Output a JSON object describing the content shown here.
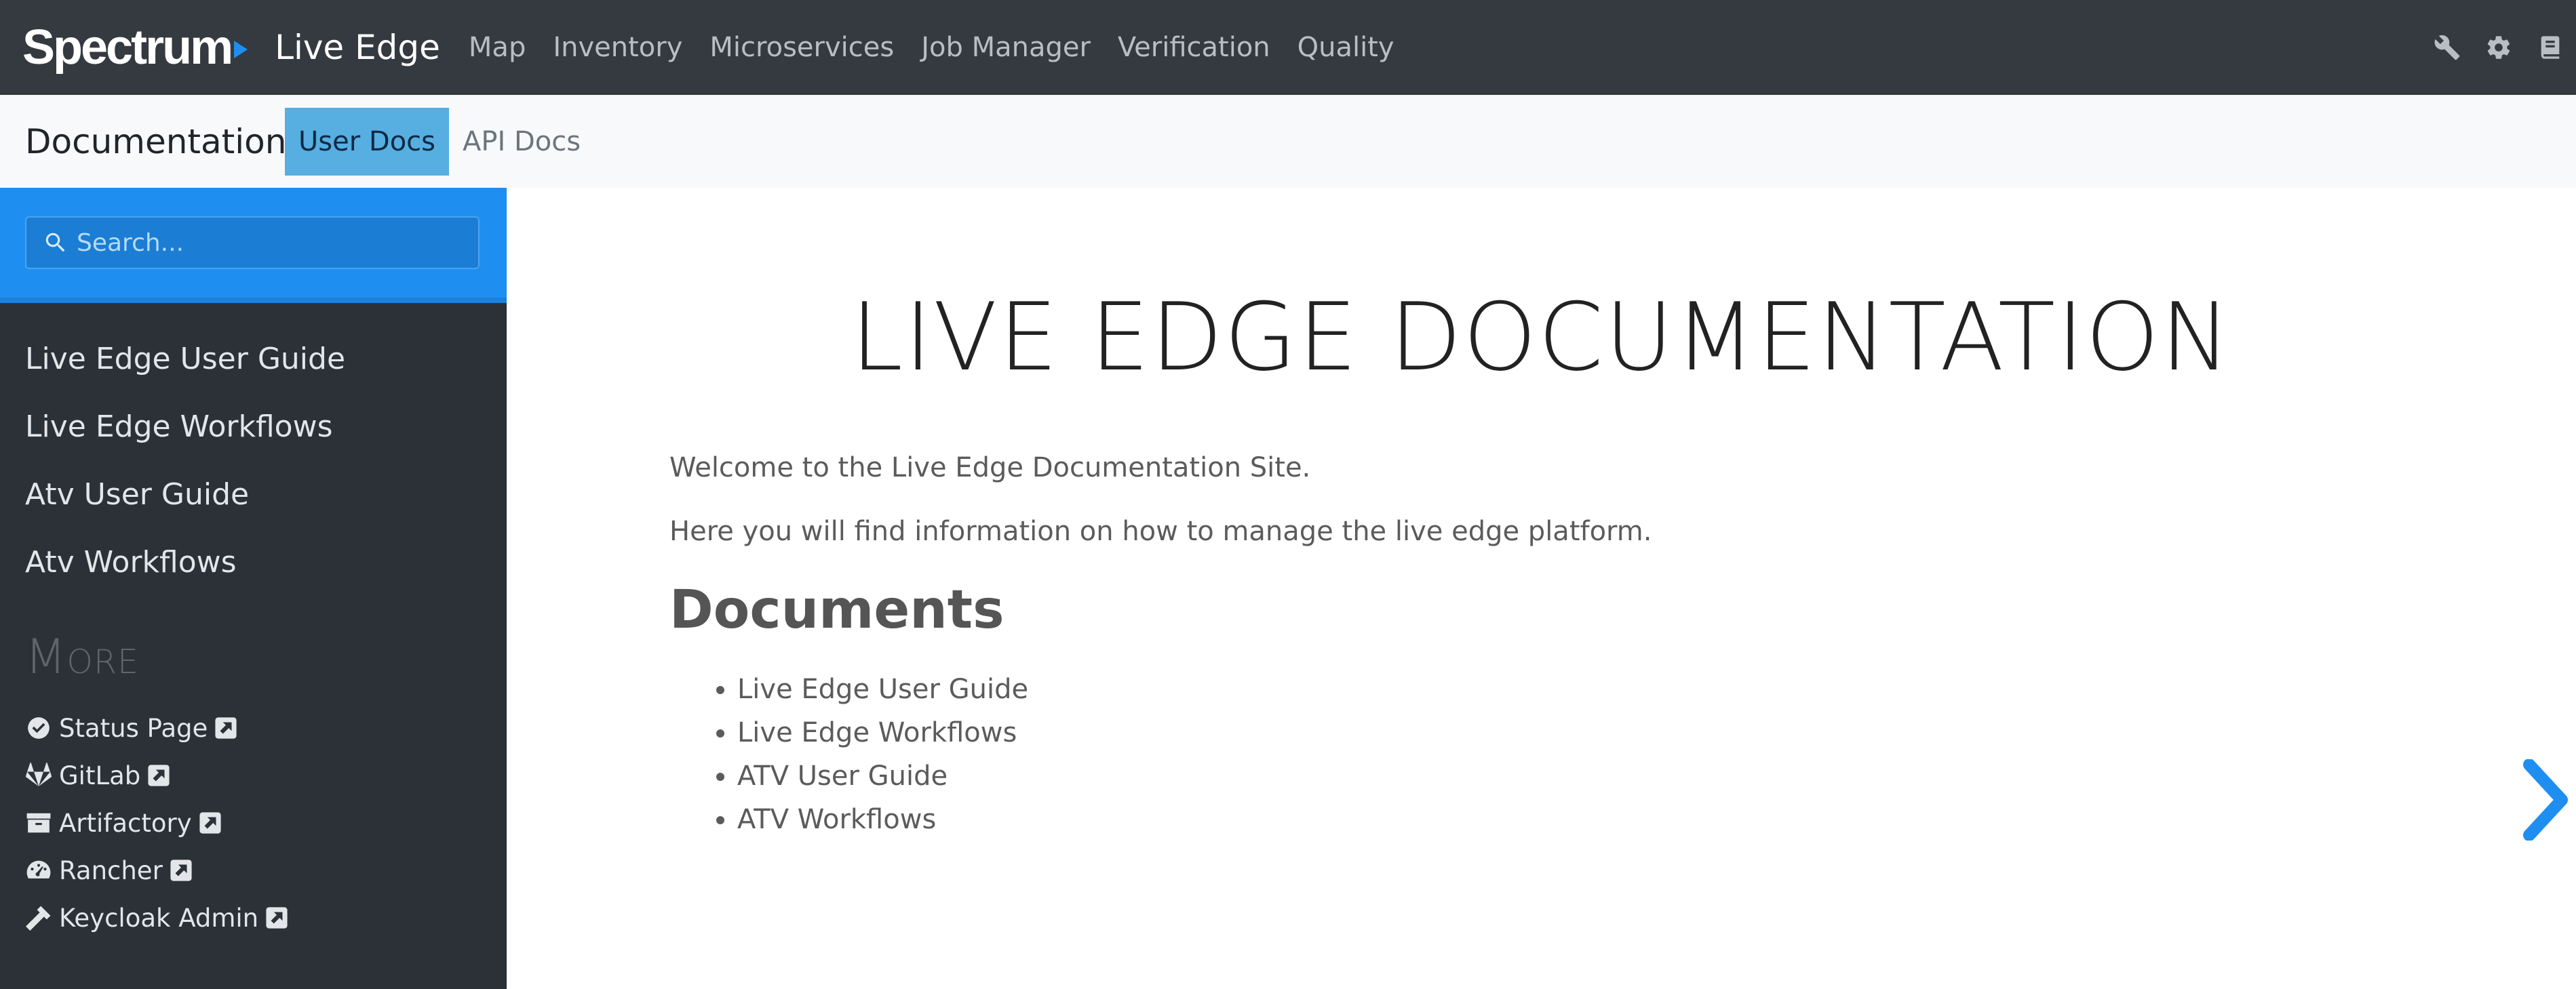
{
  "topbar": {
    "brand": "Spectrum",
    "app_name": "Live Edge",
    "nav": [
      "Map",
      "Inventory",
      "Microservices",
      "Job Manager",
      "Verification",
      "Quality"
    ],
    "icons": [
      "wrench-icon",
      "gear-icon",
      "book-icon"
    ]
  },
  "subbar": {
    "title": "Documentation",
    "tabs": [
      {
        "label": "User Docs",
        "active": true
      },
      {
        "label": "API Docs",
        "active": false
      }
    ]
  },
  "sidebar": {
    "search_placeholder": "Search...",
    "items": [
      "Live Edge User Guide",
      "Live Edge Workflows",
      "Atv User Guide",
      "Atv Workflows"
    ],
    "more_heading": "More",
    "external": [
      {
        "label": "Status Page",
        "icon": "check-circle-icon"
      },
      {
        "label": "GitLab",
        "icon": "gitlab-icon"
      },
      {
        "label": "Artifactory",
        "icon": "archive-icon"
      },
      {
        "label": "Rancher",
        "icon": "gauge-icon"
      },
      {
        "label": "Keycloak Admin",
        "icon": "hammer-icon"
      }
    ]
  },
  "main": {
    "title": "LIVE EDGE DOCUMENTATION",
    "paragraphs": [
      "Welcome to the Live Edge Documentation Site.",
      "Here you will find information on how to manage the live edge platform."
    ],
    "documents_heading": "Documents",
    "documents": [
      "Live Edge User Guide",
      "Live Edge Workflows",
      "ATV User Guide",
      "ATV Workflows"
    ]
  },
  "colors": {
    "topbar": "#343a40",
    "accent": "#1e8ff1",
    "active_tab": "#57aee1",
    "sidebar": "#2b3137"
  }
}
